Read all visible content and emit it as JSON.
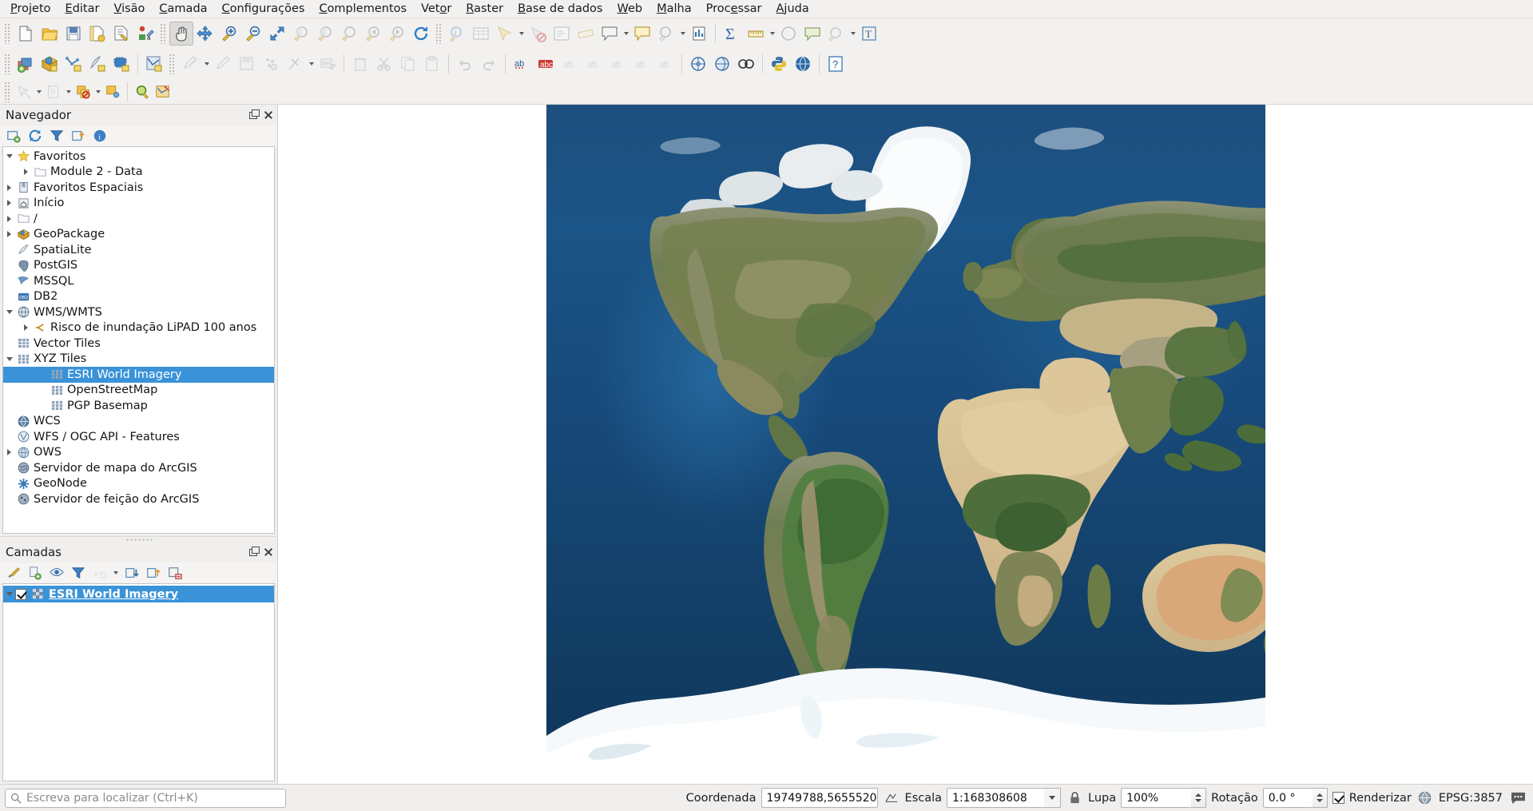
{
  "app": {
    "title": "QGIS",
    "accent_selection": "#3a93d8"
  },
  "menubar": {
    "items": [
      {
        "label": "Projeto",
        "mnemonic": "P"
      },
      {
        "label": "Editar",
        "mnemonic": "E"
      },
      {
        "label": "Visão",
        "mnemonic": "V"
      },
      {
        "label": "Camada",
        "mnemonic": "C"
      },
      {
        "label": "Configurações",
        "mnemonic": "C"
      },
      {
        "label": "Complementos",
        "mnemonic": "C"
      },
      {
        "label": "Vetor",
        "mnemonic": "o"
      },
      {
        "label": "Raster",
        "mnemonic": "R"
      },
      {
        "label": "Base de dados",
        "mnemonic": "B"
      },
      {
        "label": "Web",
        "mnemonic": "W"
      },
      {
        "label": "Malha",
        "mnemonic": "M"
      },
      {
        "label": "Processar",
        "mnemonic": "e"
      },
      {
        "label": "Ajuda",
        "mnemonic": "A"
      }
    ]
  },
  "toolbar_project": {
    "buttons": [
      {
        "name": "new-project-icon",
        "title": "Novo projeto"
      },
      {
        "name": "open-project-icon",
        "title": "Abrir projeto"
      },
      {
        "name": "save-project-icon",
        "title": "Salvar projeto"
      },
      {
        "name": "new-print-layout-icon",
        "title": "Novo layout de impressão"
      },
      {
        "name": "layout-manager-icon",
        "title": "Gerenciador de layouts"
      },
      {
        "name": "style-manager-icon",
        "title": "Gerenciador de estilos"
      }
    ]
  },
  "toolbar_navigation": {
    "buttons": [
      {
        "name": "pan-map-icon",
        "title": "Mover mapa",
        "active": true
      },
      {
        "name": "pan-to-selection-icon",
        "title": "Mover mapa para seleção"
      },
      {
        "name": "zoom-in-icon",
        "title": "Aproximar zoom"
      },
      {
        "name": "zoom-out-icon",
        "title": "Afastar zoom"
      },
      {
        "name": "zoom-full-icon",
        "title": "Zoom total"
      },
      {
        "name": "zoom-selection-icon",
        "title": "Zoom para seleção"
      },
      {
        "name": "zoom-layer-icon",
        "title": "Zoom para camada"
      },
      {
        "name": "zoom-native-icon",
        "title": "Zoom para resolução nativa"
      },
      {
        "name": "zoom-last-icon",
        "title": "Zoom anterior"
      },
      {
        "name": "zoom-next-icon",
        "title": "Zoom seguinte"
      },
      {
        "name": "refresh-icon",
        "title": "Atualizar"
      }
    ]
  },
  "toolbar_attributes": {
    "buttons": [
      {
        "name": "identify-features-icon",
        "title": "Identificar feições"
      },
      {
        "name": "open-attribute-table-icon",
        "title": "Abrir tabela de atributos"
      },
      {
        "name": "select-features-icon",
        "title": "Selecionar feições"
      },
      {
        "name": "deselect-features-icon",
        "title": "Desfazer seleção"
      },
      {
        "name": "select-by-expression-icon",
        "title": "Selecionar por expressão"
      },
      {
        "name": "measure-line-icon",
        "title": "Medir linha"
      },
      {
        "name": "show-map-tips-icon",
        "title": "Mostrar dicas do mapa"
      },
      {
        "name": "new-bookmark-icon",
        "title": "Novo marcador"
      },
      {
        "name": "text-annotation-icon",
        "title": "Anotação de texto"
      },
      {
        "name": "statistical-summary-icon",
        "title": "Resumo estatístico"
      },
      {
        "name": "sum-icon",
        "title": "Somatório"
      },
      {
        "name": "measure-icon",
        "title": "Medir"
      }
    ]
  },
  "toolbar_labels": {
    "buttons": [
      {
        "name": "label-toggle-icon",
        "title": "Alternar rótulos"
      },
      {
        "name": "highlight-pinned-labels-icon",
        "title": "Destacar rótulos fixados"
      },
      {
        "name": "python-console-icon",
        "title": "Console Python"
      },
      {
        "name": "web-browser-icon",
        "title": "Navegador web"
      },
      {
        "name": "help-icon",
        "title": "Ajuda"
      }
    ]
  },
  "toolbar_layers": {
    "buttons": [
      {
        "name": "add-vector-layer-icon",
        "title": "Adicionar camada vetorial"
      },
      {
        "name": "add-raster-layer-icon",
        "title": "Adicionar camada raster"
      },
      {
        "name": "add-mesh-layer-icon",
        "title": "Adicionar camada de malha"
      },
      {
        "name": "add-delimited-text-layer-icon",
        "title": "Adicionar camada de texto delimitado"
      },
      {
        "name": "add-postgis-layer-icon",
        "title": "Adicionar camada PostGIS"
      },
      {
        "name": "add-wms-layer-icon",
        "title": "Adicionar camada WMS/WMTS"
      }
    ]
  },
  "toolbar_digitizing": {
    "buttons": [
      {
        "name": "current-edits-icon",
        "title": "Edições atuais"
      },
      {
        "name": "toggle-editing-icon",
        "title": "Alternar edição"
      },
      {
        "name": "save-layer-edits-icon",
        "title": "Salvar edições da camada"
      },
      {
        "name": "add-point-feature-icon",
        "title": "Adicionar feição de ponto"
      },
      {
        "name": "vertex-tool-icon",
        "title": "Ferramenta de vértice"
      },
      {
        "name": "modify-attributes-icon",
        "title": "Modificar atributos"
      },
      {
        "name": "delete-selected-icon",
        "title": "Apagar selecionados"
      },
      {
        "name": "cut-features-icon",
        "title": "Recortar feições"
      },
      {
        "name": "copy-features-icon",
        "title": "Copiar feições"
      },
      {
        "name": "paste-features-icon",
        "title": "Colar feições"
      },
      {
        "name": "undo-icon",
        "title": "Desfazer"
      },
      {
        "name": "redo-icon",
        "title": "Refazer"
      }
    ]
  },
  "toolbar_selection": {
    "buttons": [
      {
        "name": "select-by-area-icon",
        "title": "Selecionar feições por área"
      },
      {
        "name": "select-by-value-icon",
        "title": "Selecionar feições por valor"
      },
      {
        "name": "select-all-icon",
        "title": "Selecionar tudo"
      },
      {
        "name": "invert-selection-icon",
        "title": "Inverter seleção"
      },
      {
        "name": "zoom-to-native-icon",
        "title": "Zoom nativo"
      },
      {
        "name": "map-tips-icon",
        "title": "Dicas de mapa"
      }
    ]
  },
  "browser_panel": {
    "title": "Navegador",
    "toolbar": [
      {
        "name": "add-layer-icon",
        "title": "Adicionar camadas selecionadas"
      },
      {
        "name": "refresh-icon",
        "title": "Atualizar"
      },
      {
        "name": "filter-browser-icon",
        "title": "Filtrar navegador"
      },
      {
        "name": "collapse-all-icon",
        "title": "Recolher tudo"
      },
      {
        "name": "properties-icon",
        "title": "Propriedades"
      }
    ],
    "tree": [
      {
        "label": "Favoritos",
        "icon": "star-icon",
        "indent": 0,
        "arrow": "down"
      },
      {
        "label": "Module 2 - Data",
        "icon": "folder-icon",
        "indent": 1,
        "arrow": "right"
      },
      {
        "label": "Favoritos Espaciais",
        "icon": "spatial-bookmark-icon",
        "indent": 0,
        "arrow": "right"
      },
      {
        "label": "Início",
        "icon": "home-icon",
        "indent": 0,
        "arrow": "right"
      },
      {
        "label": "/",
        "icon": "folder-icon",
        "indent": 0,
        "arrow": "right"
      },
      {
        "label": "GeoPackage",
        "icon": "geopackage-icon",
        "indent": 0,
        "arrow": "right"
      },
      {
        "label": "SpatiaLite",
        "icon": "spatialite-icon",
        "indent": 0,
        "arrow": "none"
      },
      {
        "label": "PostGIS",
        "icon": "postgis-icon",
        "indent": 0,
        "arrow": "none"
      },
      {
        "label": "MSSQL",
        "icon": "mssql-icon",
        "indent": 0,
        "arrow": "none"
      },
      {
        "label": "DB2",
        "icon": "db2-icon",
        "indent": 0,
        "arrow": "none"
      },
      {
        "label": "WMS/WMTS",
        "icon": "wms-icon",
        "indent": 0,
        "arrow": "down"
      },
      {
        "label": "Risco de inundação LiPAD 100 anos",
        "icon": "wms-connection-icon",
        "indent": 1,
        "arrow": "right"
      },
      {
        "label": "Vector Tiles",
        "icon": "vector-tiles-icon",
        "indent": 0,
        "arrow": "none"
      },
      {
        "label": "XYZ Tiles",
        "icon": "xyz-tiles-icon",
        "indent": 0,
        "arrow": "down"
      },
      {
        "label": "ESRI World Imagery",
        "icon": "xyz-tiles-icon",
        "indent": 2,
        "arrow": "none",
        "selected": true
      },
      {
        "label": "OpenStreetMap",
        "icon": "xyz-tiles-icon",
        "indent": 2,
        "arrow": "none"
      },
      {
        "label": "PGP Basemap",
        "icon": "xyz-tiles-icon",
        "indent": 2,
        "arrow": "none"
      },
      {
        "label": "WCS",
        "icon": "wcs-icon",
        "indent": 0,
        "arrow": "none"
      },
      {
        "label": "WFS / OGC API - Features",
        "icon": "wfs-icon",
        "indent": 0,
        "arrow": "none"
      },
      {
        "label": "OWS",
        "icon": "ows-icon",
        "indent": 0,
        "arrow": "right"
      },
      {
        "label": "Servidor de mapa do ArcGIS",
        "icon": "arcgis-map-server-icon",
        "indent": 0,
        "arrow": "none"
      },
      {
        "label": "GeoNode",
        "icon": "geonode-icon",
        "indent": 0,
        "arrow": "none"
      },
      {
        "label": "Servidor de feição do ArcGIS",
        "icon": "arcgis-feature-server-icon",
        "indent": 0,
        "arrow": "none"
      }
    ]
  },
  "layers_panel": {
    "title": "Camadas",
    "toolbar": [
      {
        "name": "open-layer-styling-icon",
        "title": "Abrir painel de estilo de camada"
      },
      {
        "name": "add-group-icon",
        "title": "Adicionar grupo"
      },
      {
        "name": "manage-layer-visibility-icon",
        "title": "Gerenciar visibilidade de camadas"
      },
      {
        "name": "filter-legend-icon",
        "title": "Filtrar legenda"
      },
      {
        "name": "filter-legend-expression-icon",
        "title": "Filtrar legenda por expressão",
        "disabled": true
      },
      {
        "name": "expand-all-icon",
        "title": "Expandir tudo"
      },
      {
        "name": "collapse-all-icon",
        "title": "Recolher tudo"
      },
      {
        "name": "remove-layer-icon",
        "title": "Remover camada/grupo"
      }
    ],
    "layers": [
      {
        "label": "ESRI World Imagery",
        "checked": true,
        "selected": true,
        "icon": "raster-layer-icon"
      }
    ]
  },
  "map": {
    "name": "map-canvas",
    "basemap": "ESRI World Imagery"
  },
  "statusbar": {
    "locator_placeholder": "Escreva para localizar (Ctrl+K)",
    "coordinate_label": "Coordenada",
    "coordinate_value": "19749788,5655520",
    "scale_label": "Escala",
    "scale_value": "1:168308608",
    "magnifier_label": "Lupa",
    "magnifier_value": "100%",
    "rotation_label": "Rotação",
    "rotation_value": "0.0 °",
    "render_label": "Renderizar",
    "render_checked": true,
    "crs_label": "EPSG:3857",
    "messages_name": "messages-icon"
  }
}
